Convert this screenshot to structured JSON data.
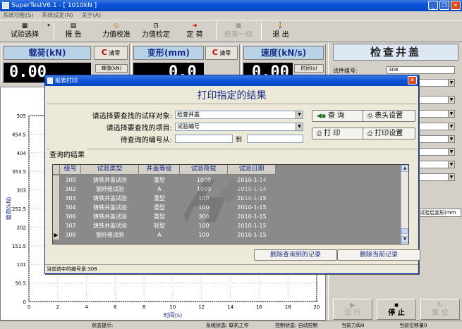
{
  "window": {
    "title": "SuperTestV6.1 - [ 1010kN ]"
  },
  "menu": [
    "系统功能(S)",
    "系统设定(N)",
    "关于(A)"
  ],
  "toolbar": {
    "test_select": "试验选择",
    "report": "报 告",
    "force_calib": "力值校准",
    "force_verify": "力值检定",
    "fixed_load": "定 荷",
    "end_group": "结束一组",
    "exit": "退 出"
  },
  "panels": {
    "load": {
      "title": "载荷(kN)",
      "clear": "清零",
      "peak": "峰值(kN)",
      "value": "0.00"
    },
    "deform": {
      "title": "变形(mm)",
      "clear": "清零",
      "value": "0.0"
    },
    "speed": {
      "title": "速度(kN/s)",
      "time": "时间(s)",
      "value": "0.00"
    }
  },
  "right": {
    "heading": "检查井盖",
    "group_label": "试件组号:",
    "group_value": "308",
    "tail_label": "验",
    "after_test_tag": "试验后变形(mm"
  },
  "bottom_buttons": {
    "run": "运 行",
    "stop": "停 止",
    "reset": "复 位"
  },
  "chart_data": {
    "type": "line",
    "xlabel": "时间(s)",
    "ylabel": "载荷(kN)",
    "xlim": [
      0,
      20
    ],
    "ylim": [
      0,
      505
    ],
    "xticks": [
      0,
      2,
      4,
      6,
      8,
      10,
      12,
      14,
      16,
      18,
      20
    ],
    "yticks": [
      0,
      50.5,
      101,
      151.5,
      202,
      252.5,
      303,
      353.5,
      404,
      454.5,
      505
    ],
    "series": []
  },
  "status": {
    "state_label": "状态提示:",
    "system_status": "系统状态: 联机工作",
    "control_status": "控制状态: 自动控制",
    "current_force": "当前力码0",
    "current_disp": "当前位移量0"
  },
  "dialog": {
    "title": "报表打印",
    "heading": "打印指定的结果",
    "select_sample_label": "请选择要查找的试样对象:",
    "select_sample_value": "检查井盖",
    "select_item_label": "请选择要查找的项目:",
    "select_item_value": "试验编号",
    "query_from_label": "待查询的编号从:",
    "to_label": "到",
    "query_btn": "查 询",
    "header_btn": "表头设置",
    "print_btn": "打 印",
    "print_settings_btn": "打印设置",
    "results_label": "查询的结果",
    "columns": [
      "组号",
      "试验类型",
      "井盖等级",
      "试验荷载",
      "试验日期"
    ],
    "rows": [
      [
        "300",
        "铸铁井盖试验",
        "重型",
        "1000",
        "2010-1-14"
      ],
      [
        "302",
        "钢纤维试验",
        "A",
        "1000",
        "2010-1-14"
      ],
      [
        "303",
        "铸铁井盖试验",
        "重型",
        "100",
        "2010-1-15"
      ],
      [
        "304",
        "铸铁井盖试验",
        "重型",
        "100",
        "2010-1-15"
      ],
      [
        "306",
        "铸铁井盖试验",
        "重型",
        "300",
        "2010-1-15"
      ],
      [
        "307",
        "铸铁井盖试验",
        "轻型",
        "100",
        "2010-1-15"
      ],
      [
        "308",
        "钢纤维试验",
        "A",
        "100",
        "2010-1-15"
      ]
    ],
    "delete_found": "删除查询到的记录",
    "delete_current": "删除当前记录",
    "status_text": "当前选中的编号是:308"
  },
  "colors": {
    "title_blue": "#0a54d8",
    "display_bg": "#000000",
    "grid_bg": "#8a8a8a",
    "dialog_bg": "#ece9d8"
  }
}
